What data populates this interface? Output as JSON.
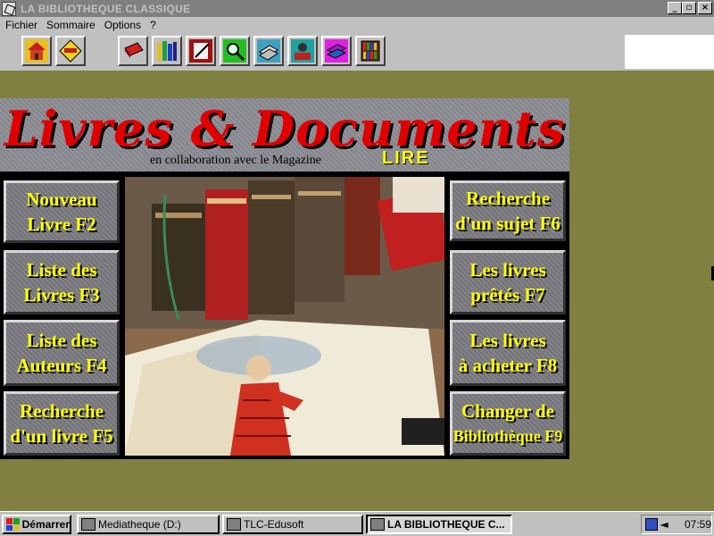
{
  "window": {
    "title": "LA BIBLIOTHEQUE CLASSIQUE",
    "buttons": [
      "_",
      "▫",
      "×"
    ]
  },
  "menu": {
    "items": [
      "Fichier",
      "Sommaire",
      "Options",
      "?"
    ]
  },
  "toolbar": {
    "buttons": [
      {
        "icon": "home-icon",
        "glyph": "⌂"
      },
      {
        "icon": "quitter-sign-icon",
        "glyph": "QUITTER"
      },
      {
        "icon": "red-book-icon",
        "glyph": "▮"
      },
      {
        "icon": "bookshelf-icon",
        "glyph": "▥"
      },
      {
        "icon": "writing-icon",
        "glyph": "✎"
      },
      {
        "icon": "magnifier-icon",
        "glyph": "⚲"
      },
      {
        "icon": "book-stack-icon",
        "glyph": "▤"
      },
      {
        "icon": "reader-icon",
        "glyph": "☻"
      },
      {
        "icon": "colored-books-icon",
        "glyph": "▦"
      },
      {
        "icon": "library-shelf-icon",
        "glyph": "▩"
      }
    ]
  },
  "banner": {
    "title": "Livres & Documents",
    "collab": "en collaboration avec le Magazine",
    "magazine": "LIRE"
  },
  "menu_buttons": {
    "left": [
      {
        "line1": "Nouveau",
        "line2": "Livre F2"
      },
      {
        "line1": "Liste des",
        "line2": "Livres F3"
      },
      {
        "line1": "Liste des",
        "line2": "Auteurs F4"
      },
      {
        "line1": "Recherche",
        "line2": "d'un livre F5"
      }
    ],
    "right": [
      {
        "line1": "Recherche",
        "line2": "d'un sujet F6"
      },
      {
        "line1": "Les livres",
        "line2": "prêtés F7"
      },
      {
        "line1": "Les livres",
        "line2": "à acheter F8"
      },
      {
        "line1": "Changer de",
        "line2": "Bibliothèque F9"
      }
    ]
  },
  "taskbar": {
    "start": "Démarrer",
    "tasks": [
      "Mediatheque (D:)",
      "TLC-Edusoft",
      "LA BIBLIOTHEQUE C..."
    ],
    "clock": "07:59"
  },
  "colors": {
    "desktop": "#808040",
    "button_text": "#ffff00",
    "logo": "#e00000"
  }
}
